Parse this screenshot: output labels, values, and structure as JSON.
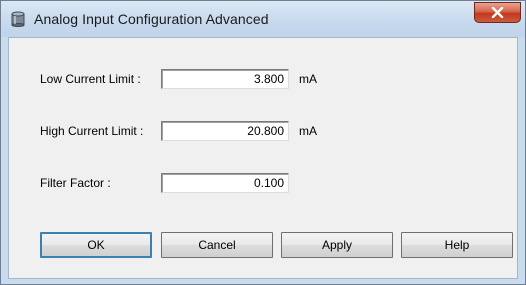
{
  "window": {
    "title": "Analog Input Configuration Advanced",
    "close_symbol": "X"
  },
  "fields": [
    {
      "label": "Low Current Limit :",
      "value": "3.800",
      "unit": "mA"
    },
    {
      "label": "High Current Limit :",
      "value": "20.800",
      "unit": "mA"
    },
    {
      "label": "Filter Factor :",
      "value": "0.100",
      "unit": ""
    }
  ],
  "buttons": {
    "ok": "OK",
    "cancel": "Cancel",
    "apply": "Apply",
    "help": "Help"
  },
  "icons": {
    "app": "database-cylinder-icon",
    "close": "close-icon"
  },
  "colors": {
    "titlebar": "#c8daee",
    "close_button": "#c2381b",
    "client_background": "#f0f0f0",
    "default_button_border": "#3c7fb1"
  }
}
